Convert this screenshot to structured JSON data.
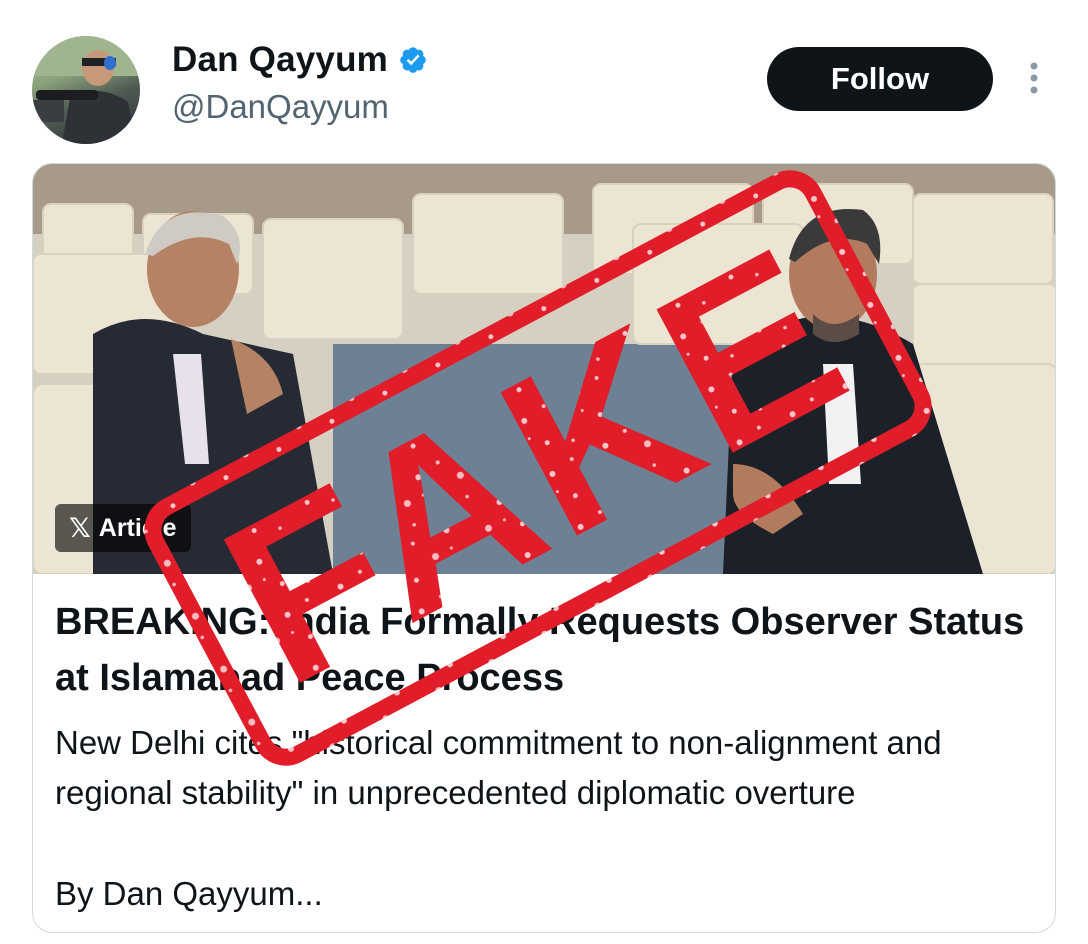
{
  "author": {
    "display_name": "Dan Qayyum",
    "handle": "@DanQayyum",
    "verified": true
  },
  "actions": {
    "follow_label": "Follow",
    "more_icon": "more-vertical-icon"
  },
  "article": {
    "badge_label": "Article",
    "badge_icon": "x-logo-icon",
    "headline": "BREAKING: India Formally Requests Observer Status at Islamabad Peace Process",
    "summary": "New Delhi cites \"historical commitment to non-alignment and regional stability\" in unprecedented diplomatic overture",
    "byline": "By Dan Qayyum..."
  },
  "stamp": {
    "text": "FAKE",
    "color": "#e11d2a"
  },
  "colors": {
    "follow_bg": "#0f1419",
    "verified": "#1d9bf0",
    "handle": "#536471",
    "card_border": "#cfd9de"
  }
}
